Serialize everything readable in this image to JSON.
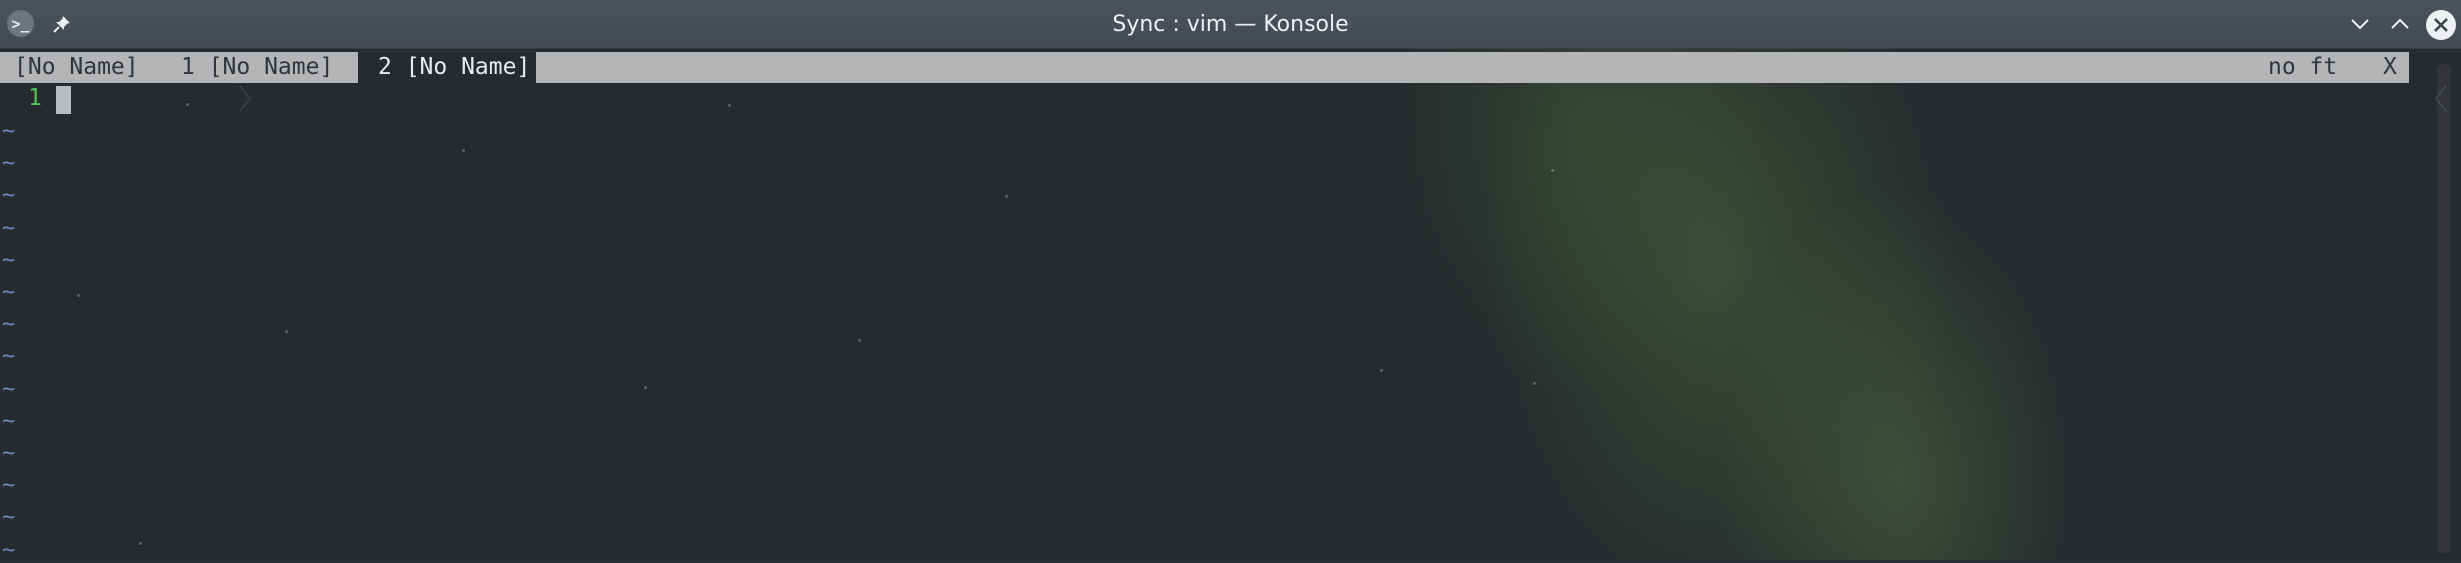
{
  "window": {
    "title": "Sync : vim — Konsole",
    "app_icon": "terminal-prompt-icon",
    "app_icon_glyph": ">_",
    "buttons": [
      "pin-icon",
      "minimize-icon",
      "maximize-icon",
      "close-icon"
    ]
  },
  "tabline": {
    "tabs": [
      {
        "label": "[No Name]"
      },
      {
        "label": "1 [No Name]"
      },
      {
        "label": "2 [No Name]",
        "selected": true
      }
    ],
    "separator": "❯",
    "right_label": "no ft",
    "right_separator": "❮",
    "close_label": "X"
  },
  "buffer": {
    "line_number": "1",
    "tilde": "~",
    "tilde_count": 14
  },
  "colors": {
    "titlebar": "#474d54",
    "tabline_bg": "#b3b5b7",
    "line_number": "#4fc25a",
    "tilde": "#6c86c5",
    "background": "#272a2e"
  }
}
